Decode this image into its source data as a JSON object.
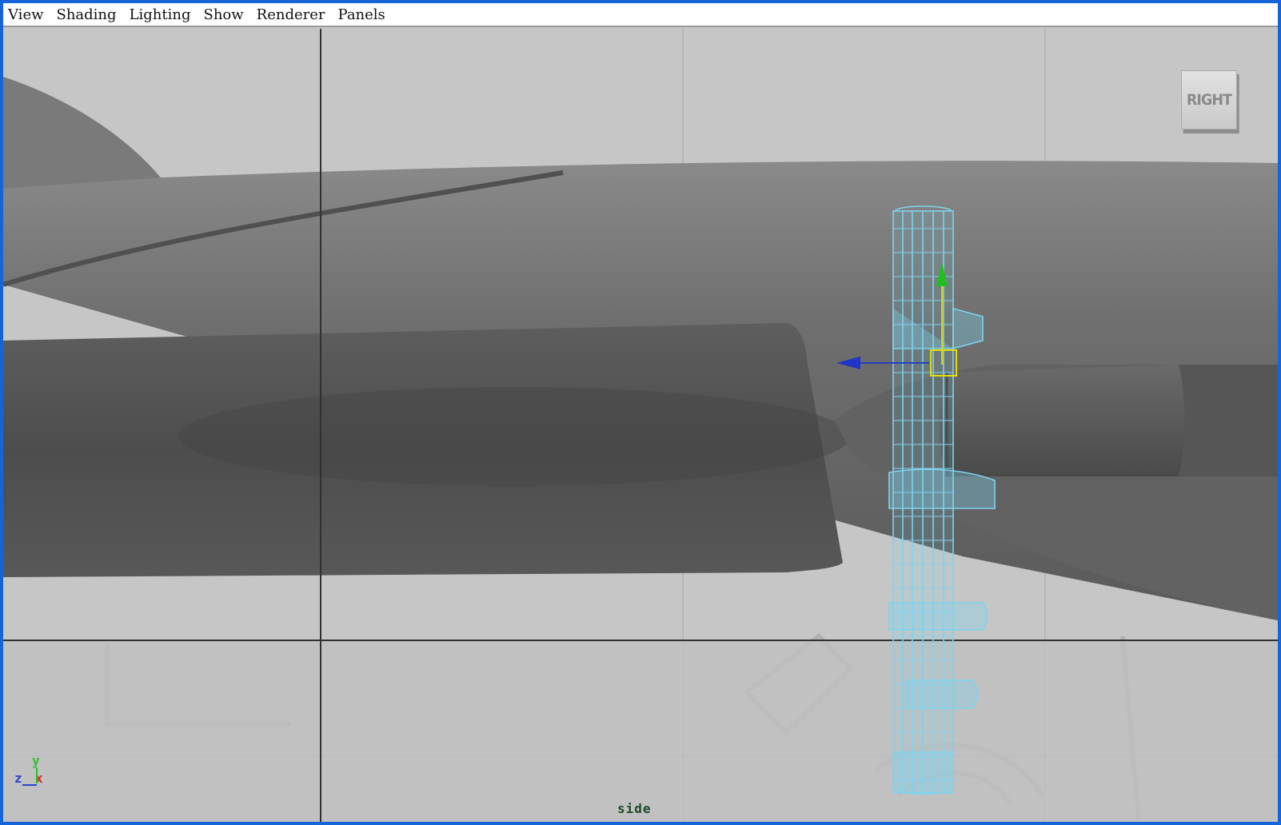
{
  "menubar": {
    "items": [
      {
        "id": "view",
        "label": "View"
      },
      {
        "id": "shading",
        "label": "Shading"
      },
      {
        "id": "lighting",
        "label": "Lighting"
      },
      {
        "id": "show",
        "label": "Show"
      },
      {
        "id": "renderer",
        "label": "Renderer"
      },
      {
        "id": "panels",
        "label": "Panels"
      }
    ]
  },
  "viewport": {
    "camera_name": "side",
    "view_cube_label": "RIGHT",
    "axis": {
      "y": "y",
      "z": "z",
      "x": "x"
    },
    "selection_color": "#7fd3ef",
    "background_color": "#c4c4c4",
    "border_color": "#1565d8"
  }
}
